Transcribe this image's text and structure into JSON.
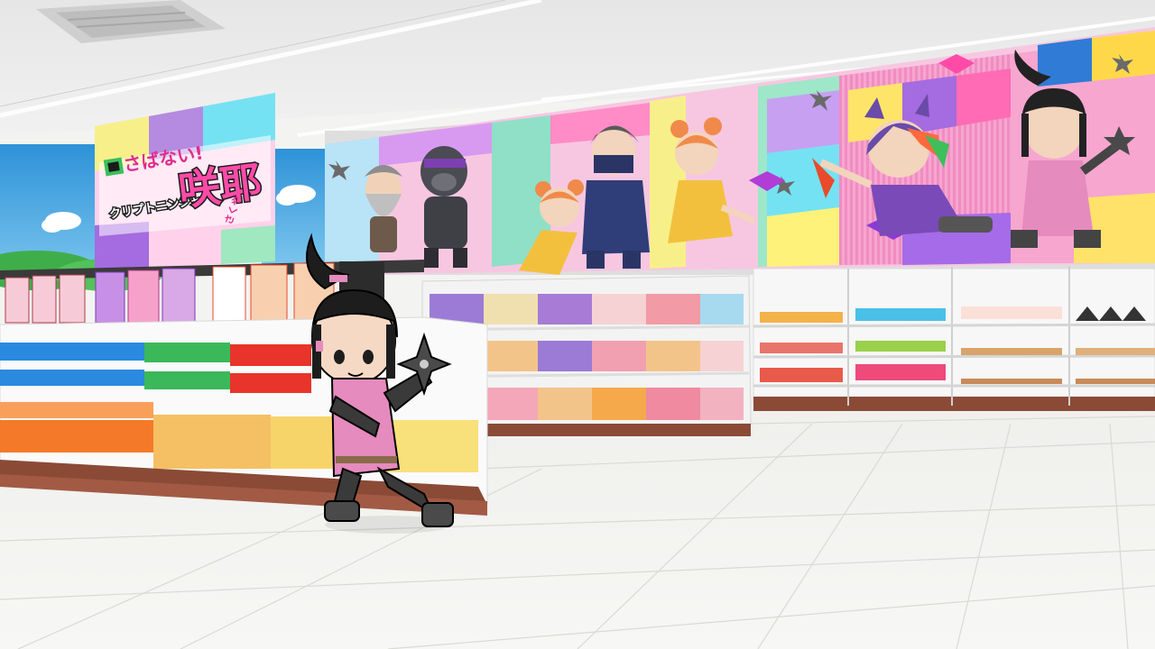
{
  "scene": {
    "type": "3d-convenience-store-interior",
    "colors": {
      "ceiling": "#e9e9e9",
      "floor": "#f1f1ee",
      "wall_sky": "#47a7e2",
      "banner_pink": "#f79acb",
      "shelf": "#f5f5f5",
      "shelf_base": "#8a4a36",
      "ninja_outfit": "#e58bbd"
    }
  },
  "banner": {
    "logo": {
      "tagline": "さばない!",
      "subtitle": "クリプトニンジャ",
      "title": "咲耶",
      "ruby": "さくや"
    },
    "characters": [
      {
        "name": "old-man-ninja",
        "icon": "elder-icon"
      },
      {
        "name": "gorilla-ninja",
        "icon": "gorilla-icon"
      },
      {
        "name": "orange-bun-girl",
        "icon": "girl-icon"
      },
      {
        "name": "masked-ninja",
        "icon": "ninja-icon"
      },
      {
        "name": "orange-bun-girl-2",
        "icon": "girl-icon"
      },
      {
        "name": "cat-eared-ninja",
        "icon": "cat-ninja-icon"
      },
      {
        "name": "sakuya-ninja",
        "icon": "sakuya-icon"
      }
    ]
  },
  "player": {
    "character": "sakuya",
    "pose": "holding-shuriken",
    "icon": "shuriken-icon"
  }
}
